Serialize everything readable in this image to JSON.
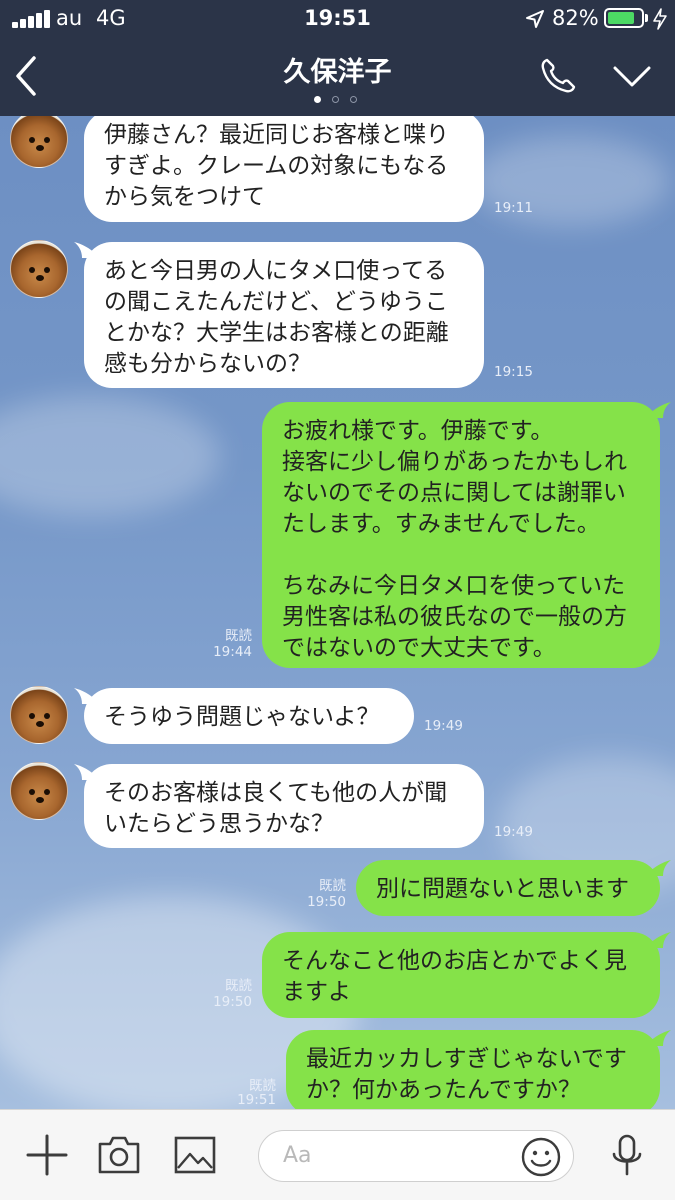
{
  "status": {
    "carrier": "au",
    "network": "4G",
    "time": "19:51",
    "battery_pct": "82%",
    "battery_level": 0.82,
    "battery_color": "#4cd964"
  },
  "header": {
    "title": "久保洋子",
    "back_icon": "chevron-left-icon",
    "call_icon": "phone-icon",
    "menu_icon": "chevron-down-icon"
  },
  "messages": [
    {
      "dir": "in",
      "text": "伊藤さん？最近同じお客様と喋りすぎよ。クレームの対象にもなるから気をつけて",
      "time": "19:11"
    },
    {
      "dir": "in",
      "text": "あと今日男の人にタメ口使ってるの聞こえたんだけど、どうゆうことかな？大学生はお客様との距離感も分からないの？",
      "time": "19:15"
    },
    {
      "dir": "out",
      "text": "お疲れ様です。伊藤です。\n接客に少し偏りがあったかもしれないのでその点に関しては謝罪いたします。すみませんでした。\n\nちなみに今日タメ口を使っていた男性客は私の彼氏なので一般の方ではないので大丈夫です。",
      "read": "既読",
      "time": "19:44"
    },
    {
      "dir": "in",
      "text": "そうゆう問題じゃないよ？",
      "time": "19:49"
    },
    {
      "dir": "in",
      "text": "そのお客様は良くても他の人が聞いたらどう思うかな？",
      "time": "19:49"
    },
    {
      "dir": "out",
      "text": "別に問題ないと思います",
      "read": "既読",
      "time": "19:50"
    },
    {
      "dir": "out",
      "text": "そんなこと他のお店とかでよく見ますよ",
      "read": "既読",
      "time": "19:50"
    },
    {
      "dir": "out",
      "text": "最近カッカしすぎじゃないですか？何かあったんですか？",
      "read": "既読",
      "time": "19:51"
    }
  ],
  "input": {
    "placeholder": "Aa",
    "icons": [
      "plus-icon",
      "camera-icon",
      "image-icon",
      "emoji-icon",
      "microphone-icon"
    ]
  },
  "colors": {
    "header_bg": "#2b3448",
    "outgoing_bubble": "#85e249",
    "incoming_bubble": "#ffffff"
  }
}
